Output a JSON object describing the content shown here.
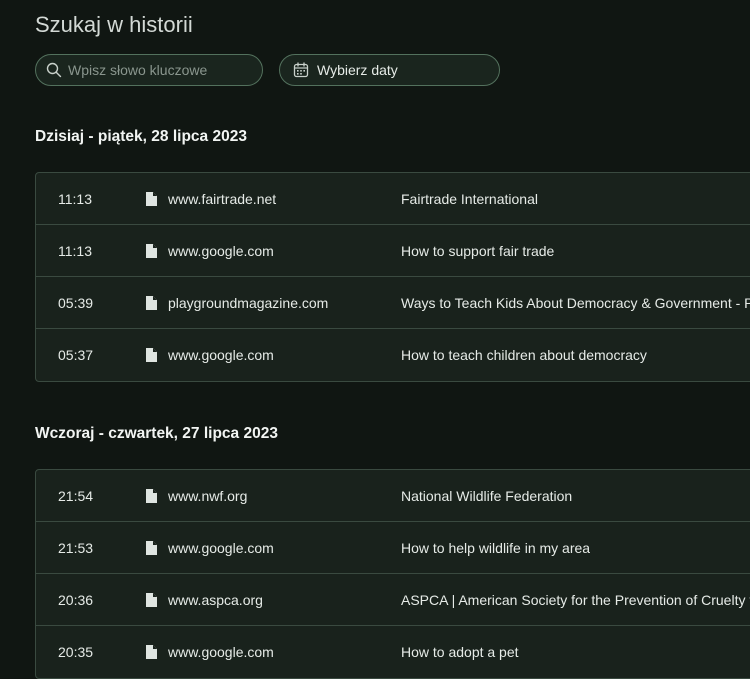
{
  "page": {
    "title": "Szukaj w historii"
  },
  "search": {
    "placeholder": "Wpisz słowo kluczowe",
    "value": ""
  },
  "date_picker": {
    "label": "Wybierz daty"
  },
  "colors": {
    "background": "#101612",
    "card": "#19221c",
    "border": "#3a4a40",
    "control_border": "#53715d",
    "text": "#e6ebe7"
  },
  "sections": [
    {
      "header": "Dzisiaj - piątek, 28 lipca 2023",
      "items": [
        {
          "time": "11:13",
          "icon": "document-icon",
          "domain": "www.fairtrade.net",
          "title": "Fairtrade International"
        },
        {
          "time": "11:13",
          "icon": "document-icon",
          "domain": "www.google.com",
          "title": "How to support fair trade"
        },
        {
          "time": "05:39",
          "icon": "document-icon",
          "domain": "playgroundmagazine.com",
          "title": "Ways to Teach Kids About Democracy & Government - PL"
        },
        {
          "time": "05:37",
          "icon": "document-icon",
          "domain": "www.google.com",
          "title": "How to teach children about democracy"
        }
      ]
    },
    {
      "header": "Wczoraj - czwartek, 27 lipca 2023",
      "items": [
        {
          "time": "21:54",
          "icon": "document-icon",
          "domain": "www.nwf.org",
          "title": "National Wildlife Federation"
        },
        {
          "time": "21:53",
          "icon": "document-icon",
          "domain": "www.google.com",
          "title": "How to help wildlife in my area"
        },
        {
          "time": "20:36",
          "icon": "document-icon",
          "domain": "www.aspca.org",
          "title": "ASPCA | American Society for the Prevention of Cruelty to"
        },
        {
          "time": "20:35",
          "icon": "document-icon",
          "domain": "www.google.com",
          "title": "How to adopt a pet"
        }
      ]
    }
  ]
}
